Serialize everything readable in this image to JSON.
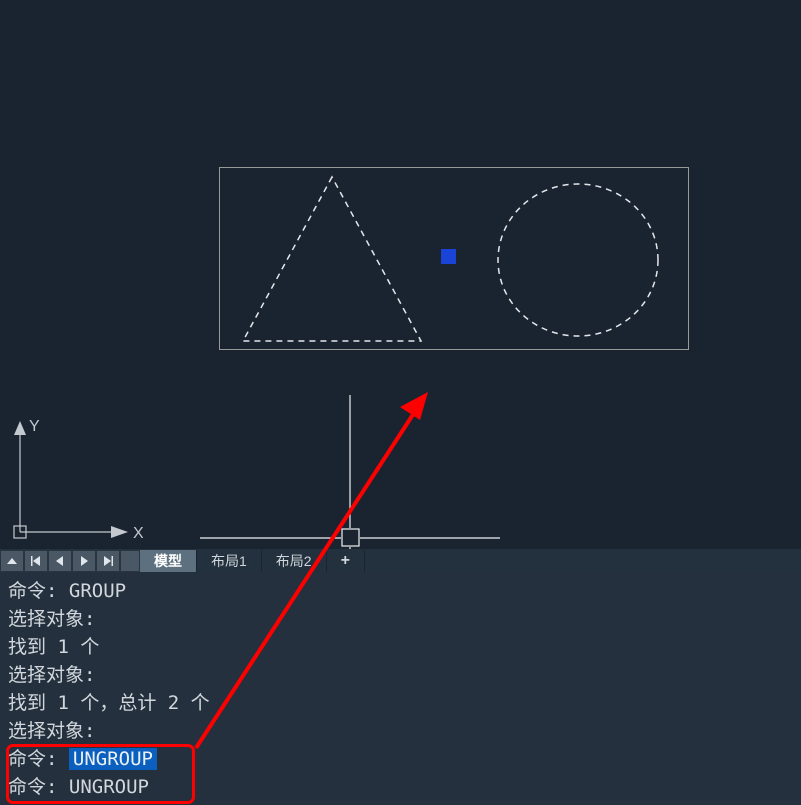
{
  "canvas": {
    "grip": "selection-grip",
    "shapes": [
      "triangle",
      "circle"
    ],
    "ucs": {
      "x_label": "X",
      "y_label": "Y"
    }
  },
  "tabs": {
    "model": "模型",
    "layout1": "布局1",
    "layout2": "布局2",
    "plus": "+"
  },
  "command_history": {
    "line1": "命令: GROUP",
    "line2": "选择对象:",
    "line3": "找到 1 个",
    "line4": "选择对象:",
    "line5": "找到 1 个，总计 2 个",
    "line6": "选择对象:",
    "line7_prefix": "命令: ",
    "line7_cmd": "UNGROUP",
    "line8": "命令: UNGROUP"
  }
}
